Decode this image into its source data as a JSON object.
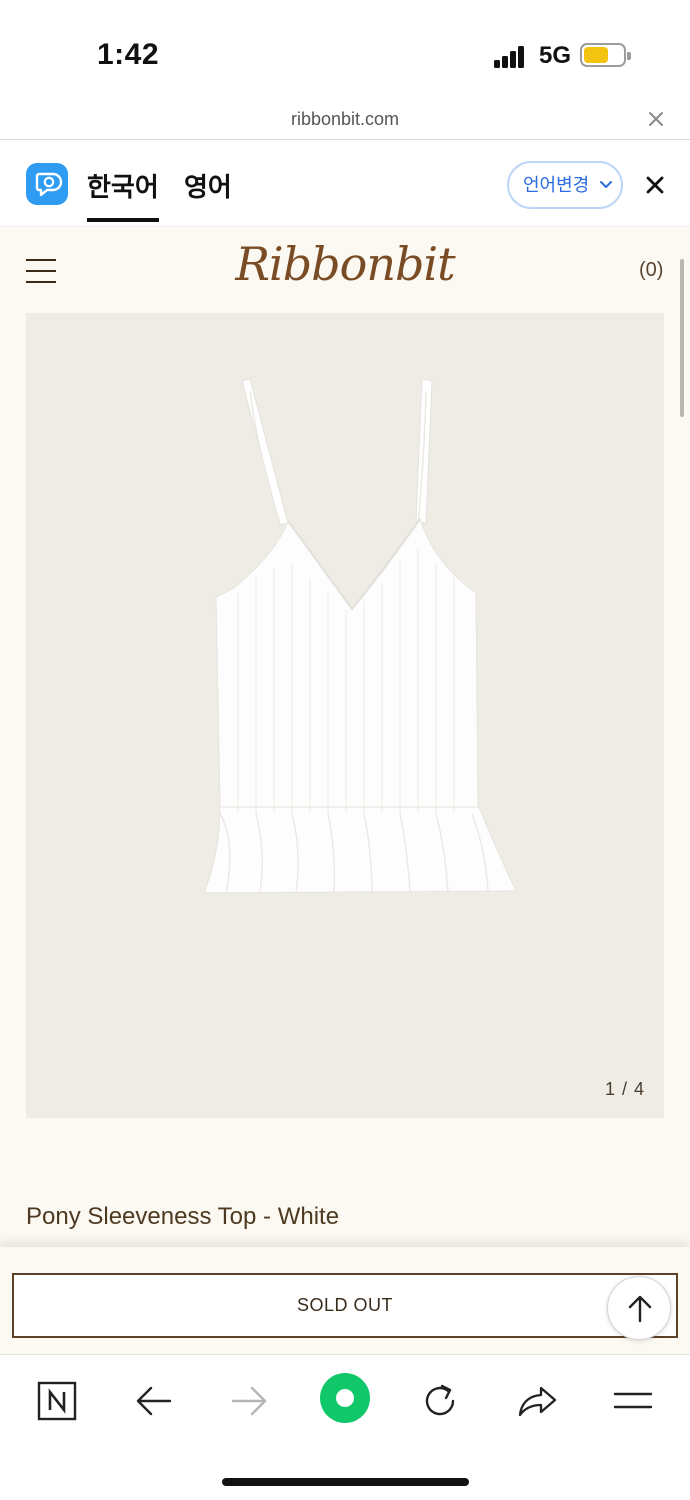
{
  "status_bar": {
    "time": "1:42",
    "network": "5G",
    "battery_color": "#f2c40f"
  },
  "url_bar": {
    "url": "ribbonbit.com"
  },
  "translate_bar": {
    "tabs": [
      {
        "label": "한국어",
        "active": true
      },
      {
        "label": "영어",
        "active": false
      }
    ],
    "change_language_label": "언어변경"
  },
  "site": {
    "logo": "Ribbonbit",
    "cart_count": "(0)",
    "image_counter": "1 / 4",
    "product_title": "Pony Sleeveness Top - White",
    "background_color": "#fbf9f1",
    "accent_color": "#7a4c26"
  },
  "actions": {
    "sold_out_label": "SOLD OUT"
  },
  "toolbar": {
    "icons": [
      "naver-icon",
      "back-arrow-icon",
      "forward-arrow-icon",
      "green-dot-icon",
      "refresh-icon",
      "share-icon",
      "menu-icon"
    ],
    "green_color": "#10c86a"
  }
}
